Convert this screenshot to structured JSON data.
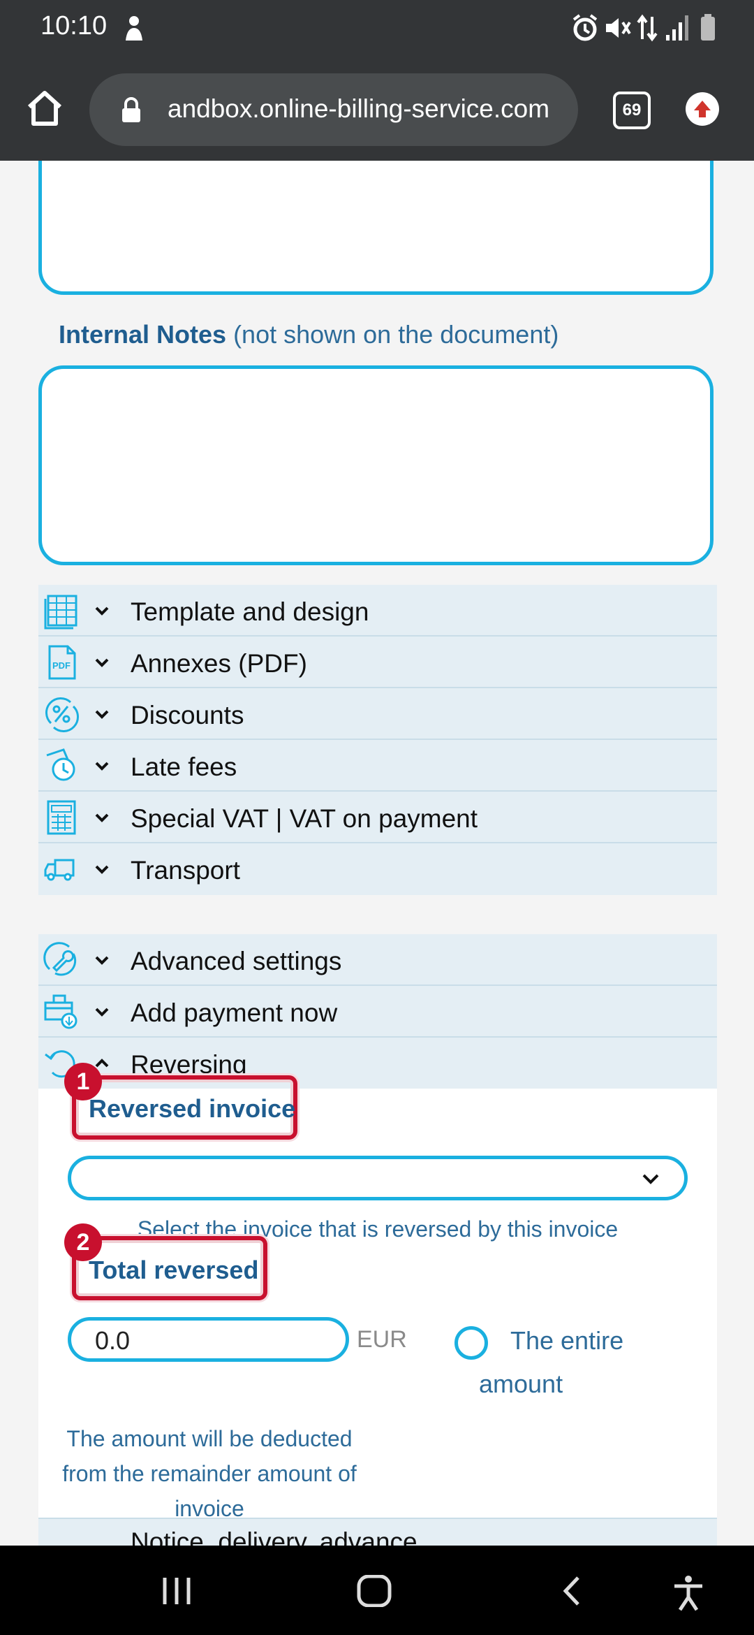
{
  "status_bar": {
    "time": "10:10"
  },
  "browser": {
    "url": "andbox.online-billing-service.com",
    "tab_count": "69"
  },
  "internal_notes": {
    "label": "Internal Notes",
    "hint": "(not shown on the document)"
  },
  "accordion_primary": [
    {
      "label": "Template and design",
      "icon": "table-icon"
    },
    {
      "label": "Annexes (PDF)",
      "icon": "pdf-icon"
    },
    {
      "label": "Discounts",
      "icon": "percent-icon"
    },
    {
      "label": "Late fees",
      "icon": "clock-money-icon"
    },
    {
      "label": "Special VAT | VAT on payment",
      "icon": "calculator-icon"
    },
    {
      "label": "Transport",
      "icon": "truck-icon"
    }
  ],
  "accordion_secondary": [
    {
      "label": "Advanced settings",
      "icon": "wrench-icon"
    },
    {
      "label": "Add payment now",
      "icon": "payment-icon"
    },
    {
      "label": "Reversing",
      "icon": "reverse-icon"
    }
  ],
  "reversing": {
    "reversed_invoice_label": "Reversed invoice",
    "reversed_invoice_hint": "Select the invoice that is reversed by this invoice",
    "total_reversed_label": "Total reversed",
    "total_value": "0.0",
    "currency": "EUR",
    "entire_amount_label": "The entire amount",
    "deduct_hint": "The amount will be deducted from the remainder amount of invoice",
    "callout_1": "1",
    "callout_2": "2"
  },
  "next_section_peek": "Notice, delivery, advance",
  "colors": {
    "accent": "#1ab0e0",
    "label_blue": "#1f5d8f",
    "callout_red": "#c8102e",
    "accordion_bg": "#e4eef4"
  }
}
